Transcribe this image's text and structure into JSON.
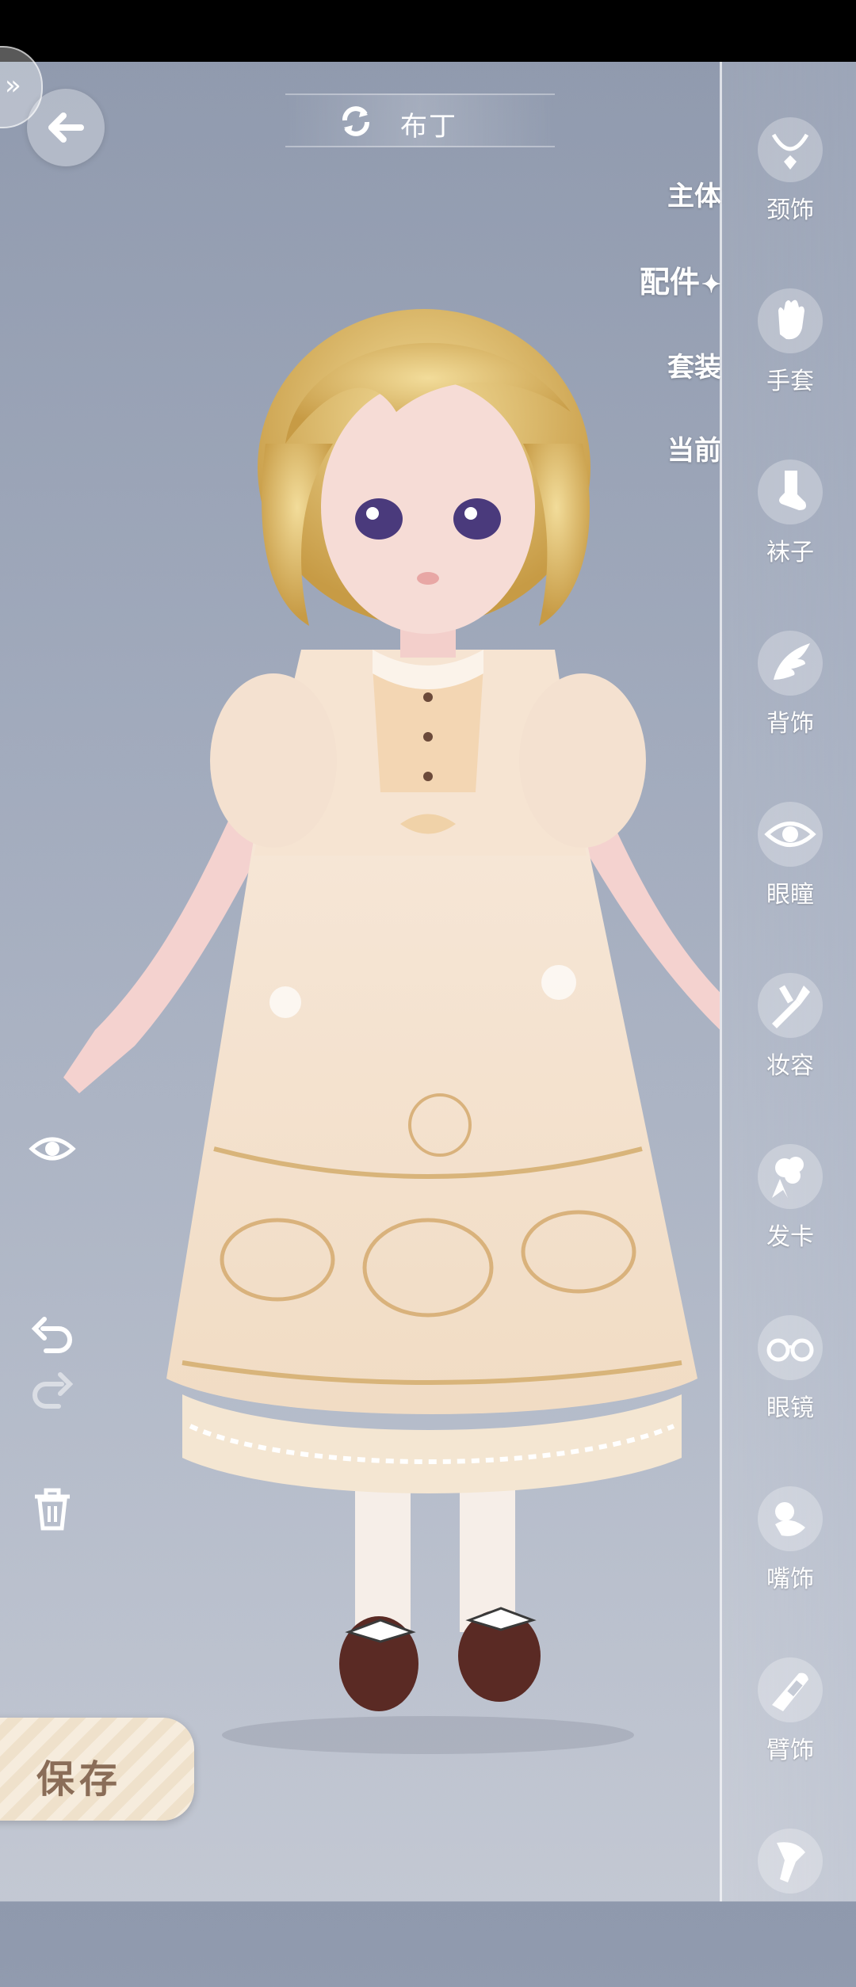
{
  "header": {
    "character_name": "布丁"
  },
  "category_tabs": [
    {
      "label": "主体",
      "active": false
    },
    {
      "label": "配件",
      "active": true
    },
    {
      "label": "套装",
      "active": false
    },
    {
      "label": "当前",
      "active": false
    }
  ],
  "slots": [
    {
      "label": "颈饰",
      "icon": "necklace-icon"
    },
    {
      "label": "手套",
      "icon": "glove-icon"
    },
    {
      "label": "袜子",
      "icon": "sock-icon"
    },
    {
      "label": "背饰",
      "icon": "wing-icon"
    },
    {
      "label": "眼瞳",
      "icon": "eye-icon"
    },
    {
      "label": "妆容",
      "icon": "makeup-brush-icon"
    },
    {
      "label": "发卡",
      "icon": "hairclip-icon"
    },
    {
      "label": "眼镜",
      "icon": "glasses-icon"
    },
    {
      "label": "嘴饰",
      "icon": "pacifier-icon"
    },
    {
      "label": "臂饰",
      "icon": "armband-icon"
    },
    {
      "label": "",
      "icon": "partial-icon"
    }
  ],
  "tools": [
    "eye-toggle-icon",
    "undo-icon",
    "redo-icon",
    "trash-icon"
  ],
  "save": {
    "label": "保存"
  },
  "colors": {
    "background": "#a2abbd",
    "accent": "#ffffff",
    "save_text": "#8a6d58"
  }
}
